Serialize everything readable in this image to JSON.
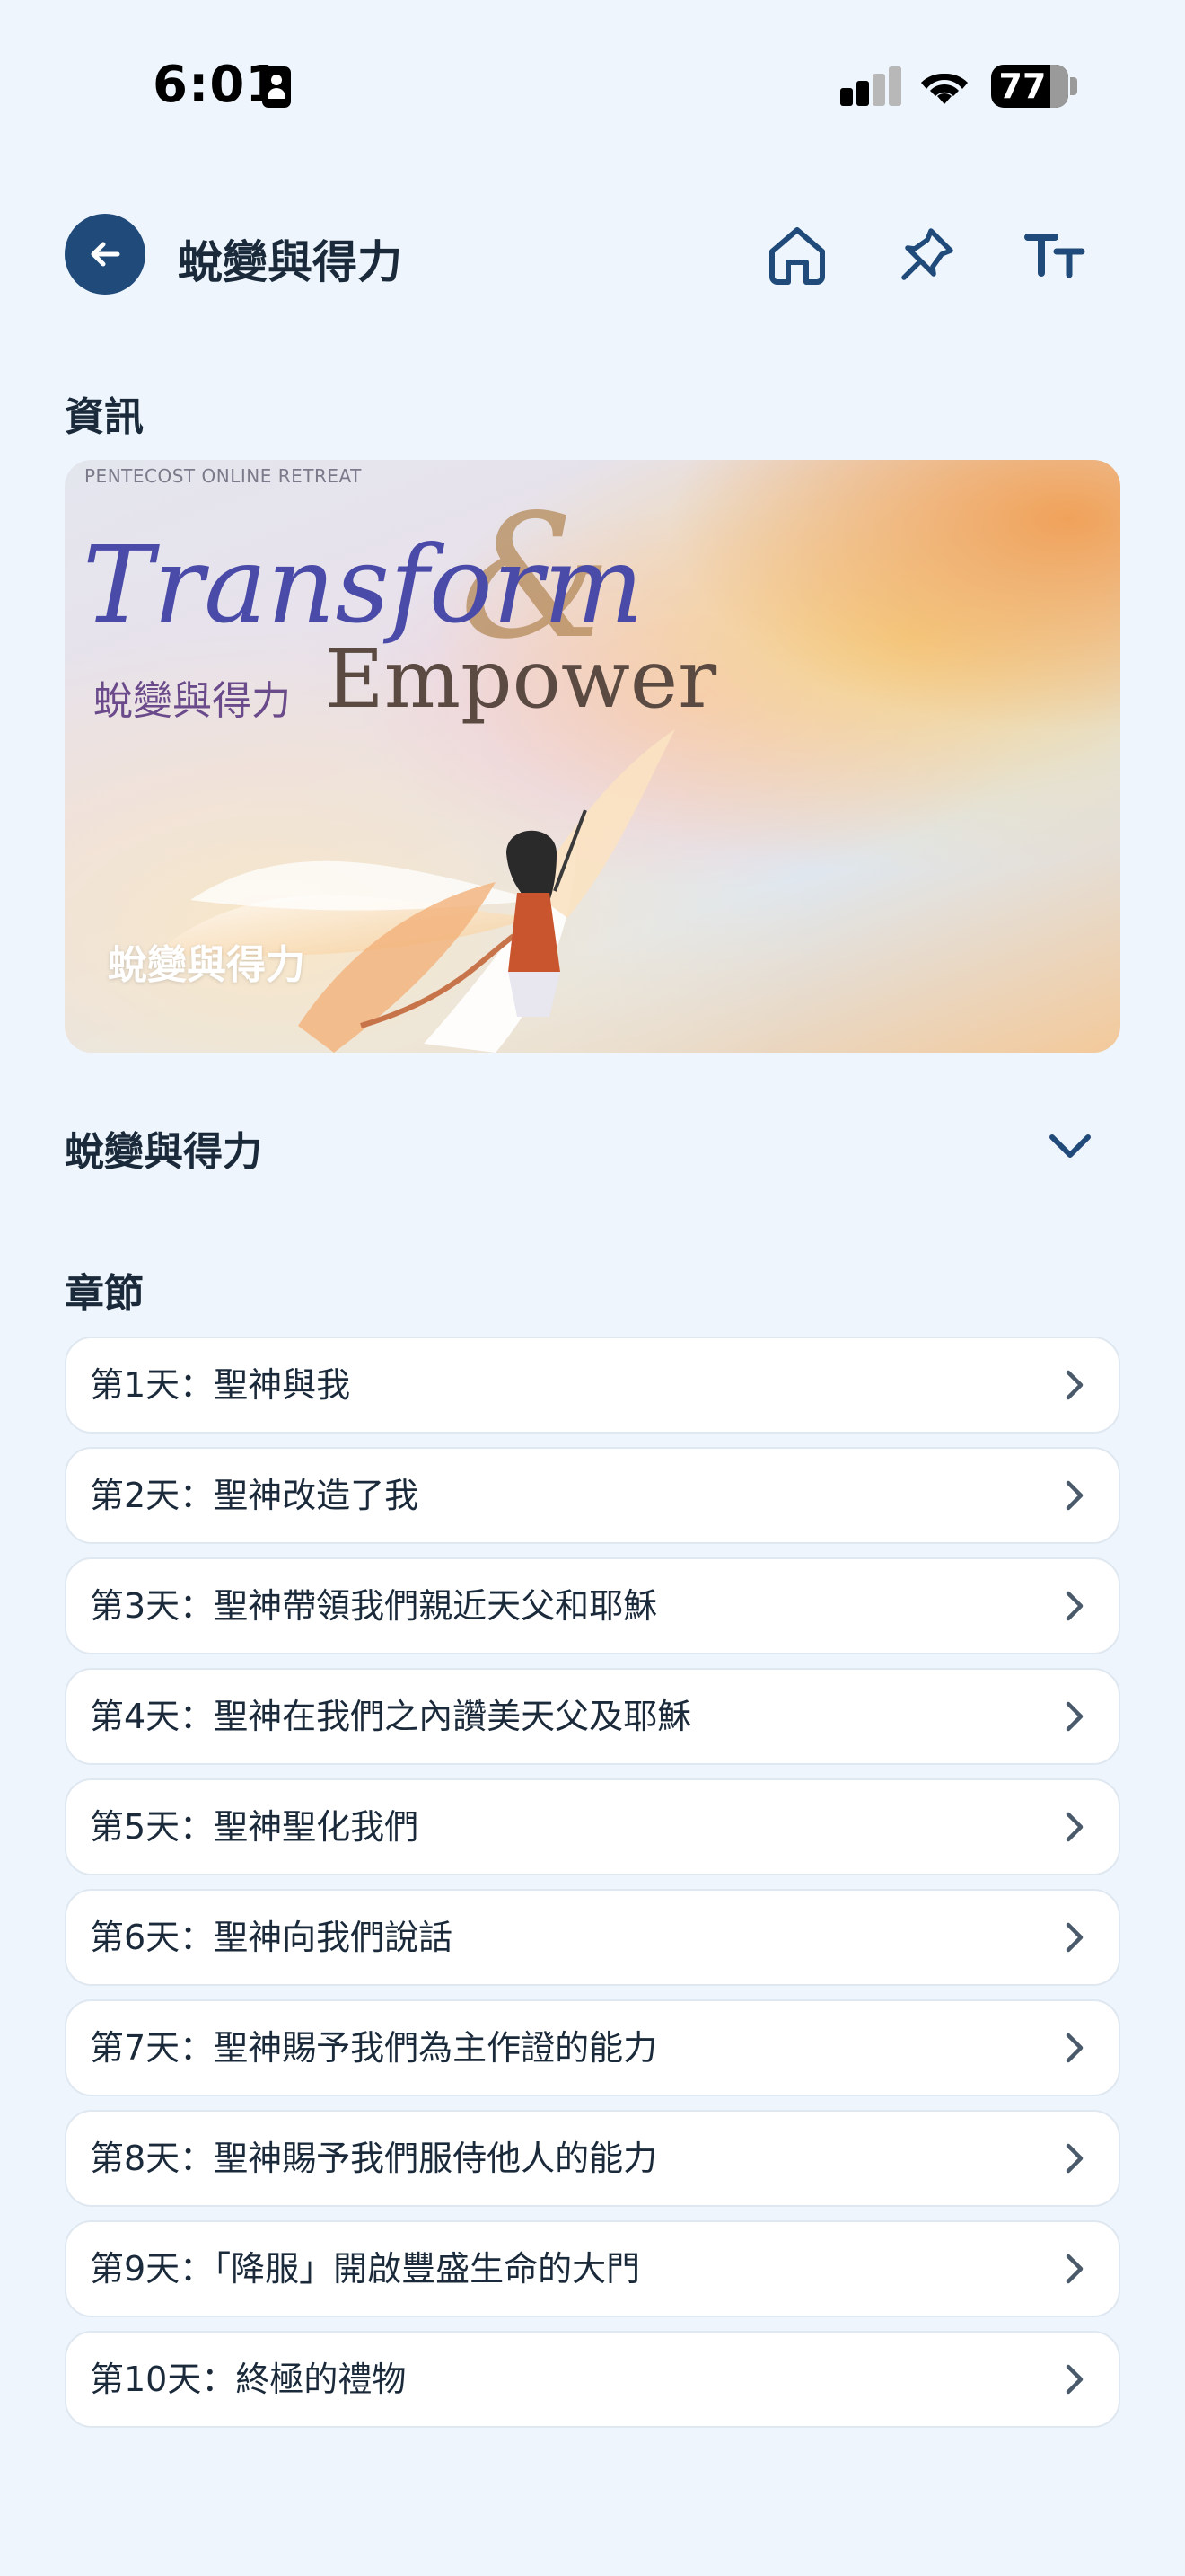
{
  "status_bar": {
    "time": "6:01",
    "battery": "77"
  },
  "header": {
    "title": "蛻變與得力"
  },
  "sections": {
    "info_label": "資訊",
    "chapters_label": "章節"
  },
  "banner": {
    "eyebrow": "PENTECOST ONLINE RETREAT",
    "title_en": "Transform",
    "ampersand": "&",
    "title_zh": "蛻變與得力",
    "subtitle_en": "Empower",
    "caption": "蛻變與得力"
  },
  "accordion": {
    "title": "蛻變與得力"
  },
  "chapters": [
    {
      "label": "第1天：聖神與我"
    },
    {
      "label": "第2天：聖神改造了我"
    },
    {
      "label": "第3天：聖神帶領我們親近天父和耶穌"
    },
    {
      "label": "第4天：聖神在我們之內讚美天父及耶穌"
    },
    {
      "label": "第5天：聖神聖化我們"
    },
    {
      "label": "第6天：聖神向我們說話"
    },
    {
      "label": "第7天：聖神賜予我們為主作證的能力"
    },
    {
      "label": "第8天：聖神賜予我們服侍他人的能力"
    },
    {
      "label": "第9天：「降服」開啟豐盛生命的大門"
    },
    {
      "label": "第10天：終極的禮物"
    }
  ],
  "colors": {
    "background": "#eef5fc",
    "accent": "#1f4a79",
    "text": "#1b2a3a"
  },
  "icons": {
    "back": "arrow-left-icon",
    "home": "home-icon",
    "pin": "pin-icon",
    "font_size": "text-size-icon",
    "expand": "chevron-down-icon",
    "row": "chevron-right-icon"
  }
}
